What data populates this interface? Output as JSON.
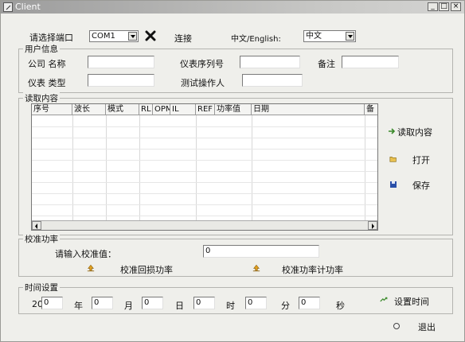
{
  "window": {
    "title": "Client",
    "controls": [
      "_",
      "□",
      "×"
    ]
  },
  "top": {
    "port_label": "请选择端口",
    "port_value": "COM1",
    "connect_label": "连接",
    "lang_label": "中文/English:",
    "lang_value": "中文"
  },
  "user_info": {
    "group_label": "用户信息",
    "company_label": "公司 名称",
    "serial_label": "仪表序列号",
    "remark_label": "备注",
    "meter_type_label": "仪表 类型",
    "operator_label": "测试操作人"
  },
  "read": {
    "group_label": "读取内容",
    "columns": [
      "序号",
      "波长",
      "模式",
      "RL",
      "OPM",
      "IL",
      "REF",
      "功率值",
      "日期",
      "备注"
    ],
    "read_button": "读取内容",
    "open_button": "打开",
    "save_button": "保存"
  },
  "calibrate": {
    "group_label": "校准功率",
    "prompt": "请输入校准值：",
    "value": "0",
    "return_loss_button": "校准回损功率",
    "power_meter_button": "校准功率计功率"
  },
  "time": {
    "group_label": "时间设置",
    "year_prefix": "20",
    "year": "0",
    "year_label": "年",
    "month": "0",
    "month_label": "月",
    "day": "0",
    "day_label": "日",
    "hour": "0",
    "hour_label": "时",
    "minute": "0",
    "minute_label": "分",
    "second": "0",
    "second_label": "秒",
    "set_time_button": "设置时间",
    "exit_button": "退出"
  }
}
